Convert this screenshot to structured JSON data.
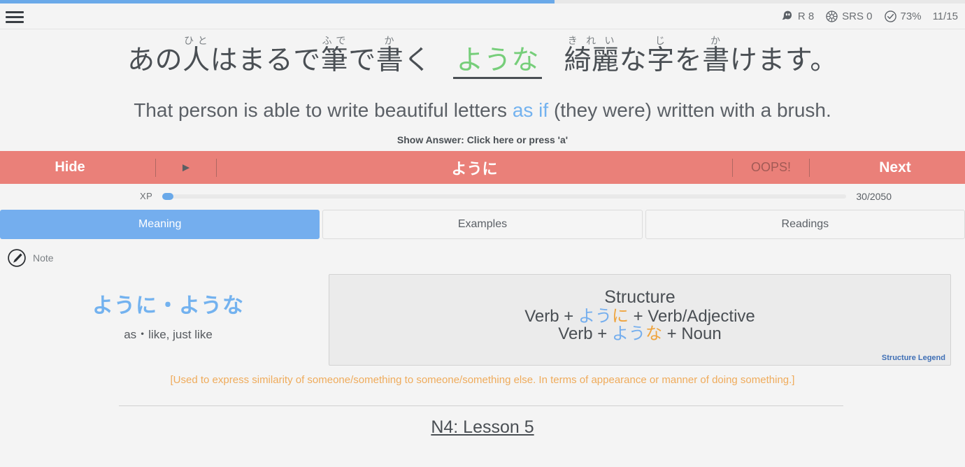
{
  "top_progress": {
    "percent": 57,
    "color": "#6aa9e9"
  },
  "header": {
    "menu_icon": "hamburger-menu-icon",
    "stats": [
      {
        "icon": "ghost-icon",
        "label": "R 8"
      },
      {
        "icon": "srs-wheel-icon",
        "label": "SRS 0"
      },
      {
        "icon": "check-circle-icon",
        "label": "73%"
      },
      {
        "icon": "",
        "label": "11/15"
      }
    ]
  },
  "question": {
    "japanese_segments": [
      {
        "text": "あ",
        "furigana": ""
      },
      {
        "text": "の",
        "furigana": ""
      },
      {
        "text": "人",
        "furigana": "ひと"
      },
      {
        "text": "は",
        "furigana": ""
      },
      {
        "text": "ま",
        "furigana": ""
      },
      {
        "text": "る",
        "furigana": ""
      },
      {
        "text": "で",
        "furigana": ""
      },
      {
        "text": "筆",
        "furigana": "ふで"
      },
      {
        "text": "で",
        "furigana": ""
      },
      {
        "text": "書",
        "furigana": "か"
      },
      {
        "text": "く",
        "furigana": ""
      }
    ],
    "target_phrase": "ような",
    "japanese_tail_segments": [
      {
        "text": "綺麗",
        "furigana": "きれい"
      },
      {
        "text": "な",
        "furigana": ""
      },
      {
        "text": "字",
        "furigana": "じ"
      },
      {
        "text": "を",
        "furigana": ""
      },
      {
        "text": "書",
        "furigana": "か"
      },
      {
        "text": "け",
        "furigana": ""
      },
      {
        "text": "ま",
        "furigana": ""
      },
      {
        "text": "す",
        "furigana": ""
      },
      {
        "text": "。",
        "furigana": ""
      }
    ],
    "english_pre": "That person is able to write beautiful letters ",
    "english_highlight": "as if",
    "english_post": " (they were) written with a brush.",
    "show_answer_hint": "Show Answer: Click here or press 'a'"
  },
  "action_bar": {
    "hide_label": "Hide",
    "play_icon": "play-triangle-icon",
    "answer_label": "ように",
    "oops_label": "OOPS!",
    "next_label": "Next",
    "color": "#ea8079"
  },
  "xp": {
    "label": "XP",
    "count": "30/2050",
    "percent": 1.5
  },
  "tabs": [
    {
      "label": "Meaning",
      "active": true
    },
    {
      "label": "Examples",
      "active": false
    },
    {
      "label": "Readings",
      "active": false
    }
  ],
  "note": {
    "icon": "pen-circle-icon",
    "label": "Note"
  },
  "meaning": {
    "title": "ように・ような",
    "subtitle": "as・like, just like"
  },
  "structure": {
    "title": "Structure",
    "line1": {
      "pre": "Verb + ",
      "blue": "よう",
      "orange": "に",
      "post": " + Verb/Adjective"
    },
    "line2": {
      "pre": "Verb + ",
      "blue": "よう",
      "orange": "な",
      "post": " + Noun"
    },
    "legend_label": "Structure Legend"
  },
  "usage_note": "[Used to express similarity of someone/something to someone/something else. In terms of appearance or manner of doing something.]",
  "lesson": {
    "label": "N4: Lesson 5"
  }
}
